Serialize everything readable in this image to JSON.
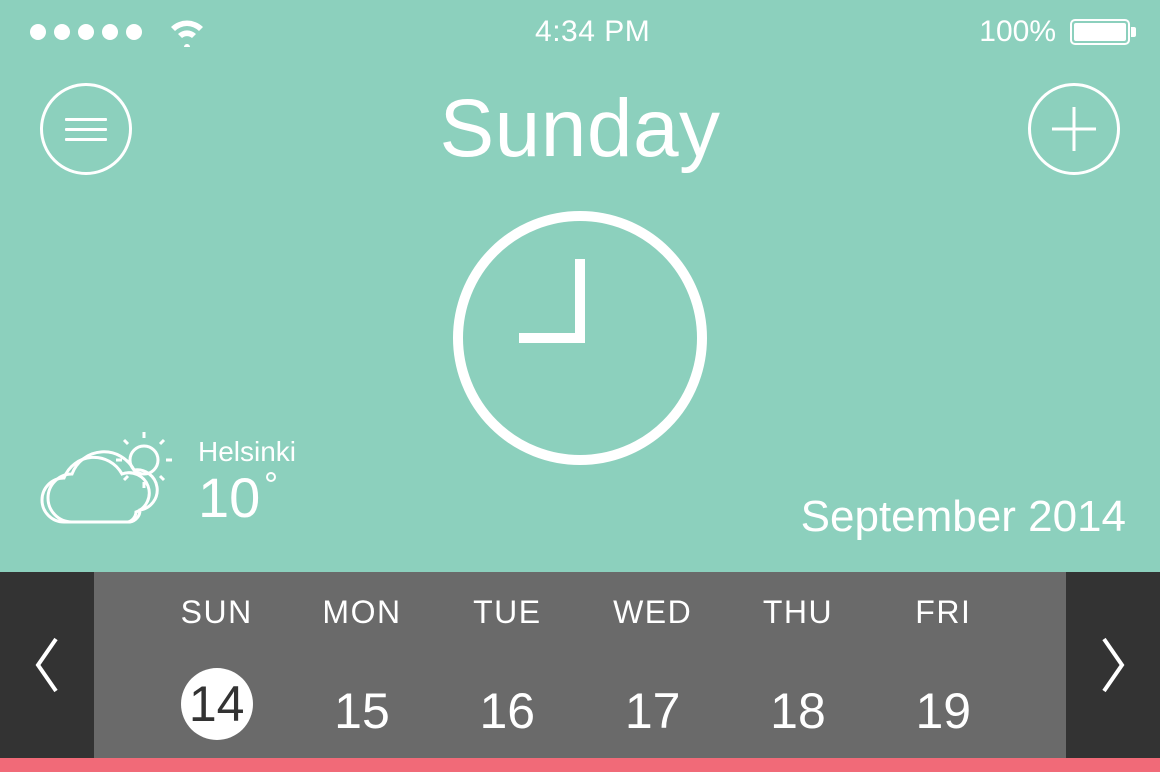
{
  "colors": {
    "hero": "#8cd0bd",
    "strip_dark": "#333333",
    "strip_light": "#6a6a6a",
    "accent": "#f16a78",
    "text": "#ffffff"
  },
  "status_bar": {
    "signal_dots": 5,
    "time": "4:34 PM",
    "battery_percent": "100%"
  },
  "header": {
    "day_title": "Sunday"
  },
  "weather": {
    "city": "Helsinki",
    "temperature": "10",
    "icon": "partly-cloudy"
  },
  "month_label": "September 2014",
  "week": {
    "days": [
      {
        "abbr": "SUN",
        "num": "14",
        "selected": true
      },
      {
        "abbr": "MON",
        "num": "15",
        "selected": false
      },
      {
        "abbr": "TUE",
        "num": "16",
        "selected": false
      },
      {
        "abbr": "WED",
        "num": "17",
        "selected": false
      },
      {
        "abbr": "THU",
        "num": "18",
        "selected": false
      },
      {
        "abbr": "FRI",
        "num": "19",
        "selected": false
      }
    ]
  }
}
